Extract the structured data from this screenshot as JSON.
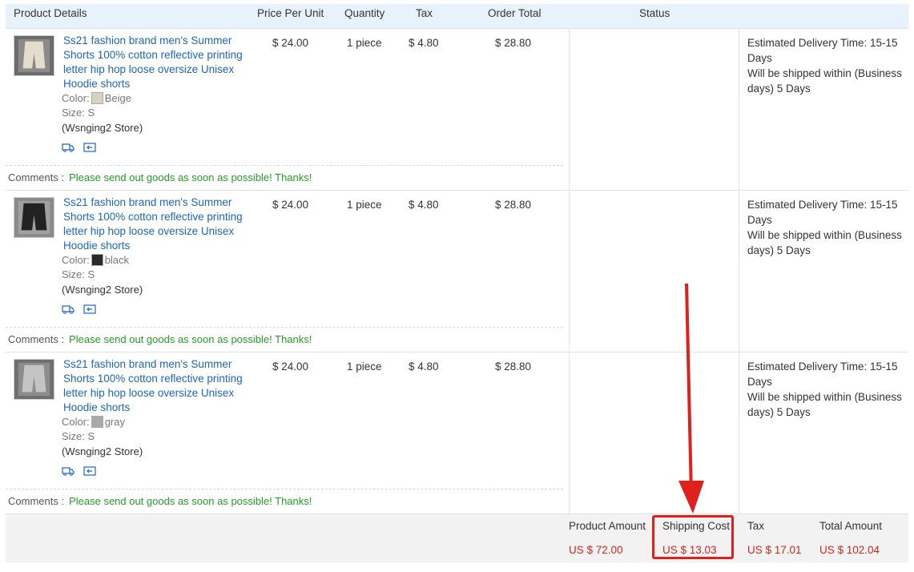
{
  "columns": {
    "product_details": "Product Details",
    "price_per_unit": "Price Per Unit",
    "quantity": "Quantity",
    "tax": "Tax",
    "order_total": "Order Total",
    "status": "Status"
  },
  "labels": {
    "color": "Color:",
    "size": "Size:",
    "comments": "Comments :"
  },
  "items": [
    {
      "title": "Ss21 fashion brand men's Summer Shorts 100% cotton reflective printing letter hip hop loose oversize Unisex Hoodie shorts",
      "color": "Beige",
      "size": "S",
      "store": "(Wsnging2 Store)",
      "price": "$ 24.00",
      "quantity": "1 piece",
      "tax": "$ 4.80",
      "total": "$ 28.80",
      "status": "Estimated Delivery Time: 15-15 Days\nWill be shipped within (Business days) 5 Days",
      "comment": "Please send out goods as soon as possible! Thanks!"
    },
    {
      "title": "Ss21 fashion brand men's Summer Shorts 100% cotton reflective printing letter hip hop loose oversize Unisex Hoodie shorts",
      "color": "black",
      "size": "S",
      "store": "(Wsnging2 Store)",
      "price": "$ 24.00",
      "quantity": "1 piece",
      "tax": "$ 4.80",
      "total": "$ 28.80",
      "status": "Estimated Delivery Time: 15-15 Days\nWill be shipped within (Business days) 5 Days",
      "comment": "Please send out goods as soon as possible! Thanks!"
    },
    {
      "title": "Ss21 fashion brand men's Summer Shorts 100% cotton reflective printing letter hip hop loose oversize Unisex Hoodie shorts",
      "color": "gray",
      "size": "S",
      "store": "(Wsnging2 Store)",
      "price": "$ 24.00",
      "quantity": "1 piece",
      "tax": "$ 4.80",
      "total": "$ 28.80",
      "status": "Estimated Delivery Time: 15-15 Days\nWill be shipped within (Business days) 5 Days",
      "comment": "Please send out goods as soon as possible! Thanks!"
    }
  ],
  "summary": {
    "product_amount_label": "Product Amount",
    "product_amount": "US $ 72.00",
    "shipping_cost_label": "Shipping Cost",
    "shipping_cost": "US $ 13.03",
    "tax_label": "Tax",
    "tax": "US $ 17.01",
    "total_amount_label": "Total Amount",
    "total_amount": "US $ 102.04"
  },
  "colors": {
    "link": "#1a66c8",
    "comment": "#22a022",
    "amount": "#d0281e",
    "annotation": "#e0201c",
    "swatches": [
      "#d8d1bd",
      "#2a2a2a",
      "#a9a9a9"
    ],
    "shorts": [
      "#e4ddcb",
      "#222222",
      "#b3b3b3"
    ]
  }
}
